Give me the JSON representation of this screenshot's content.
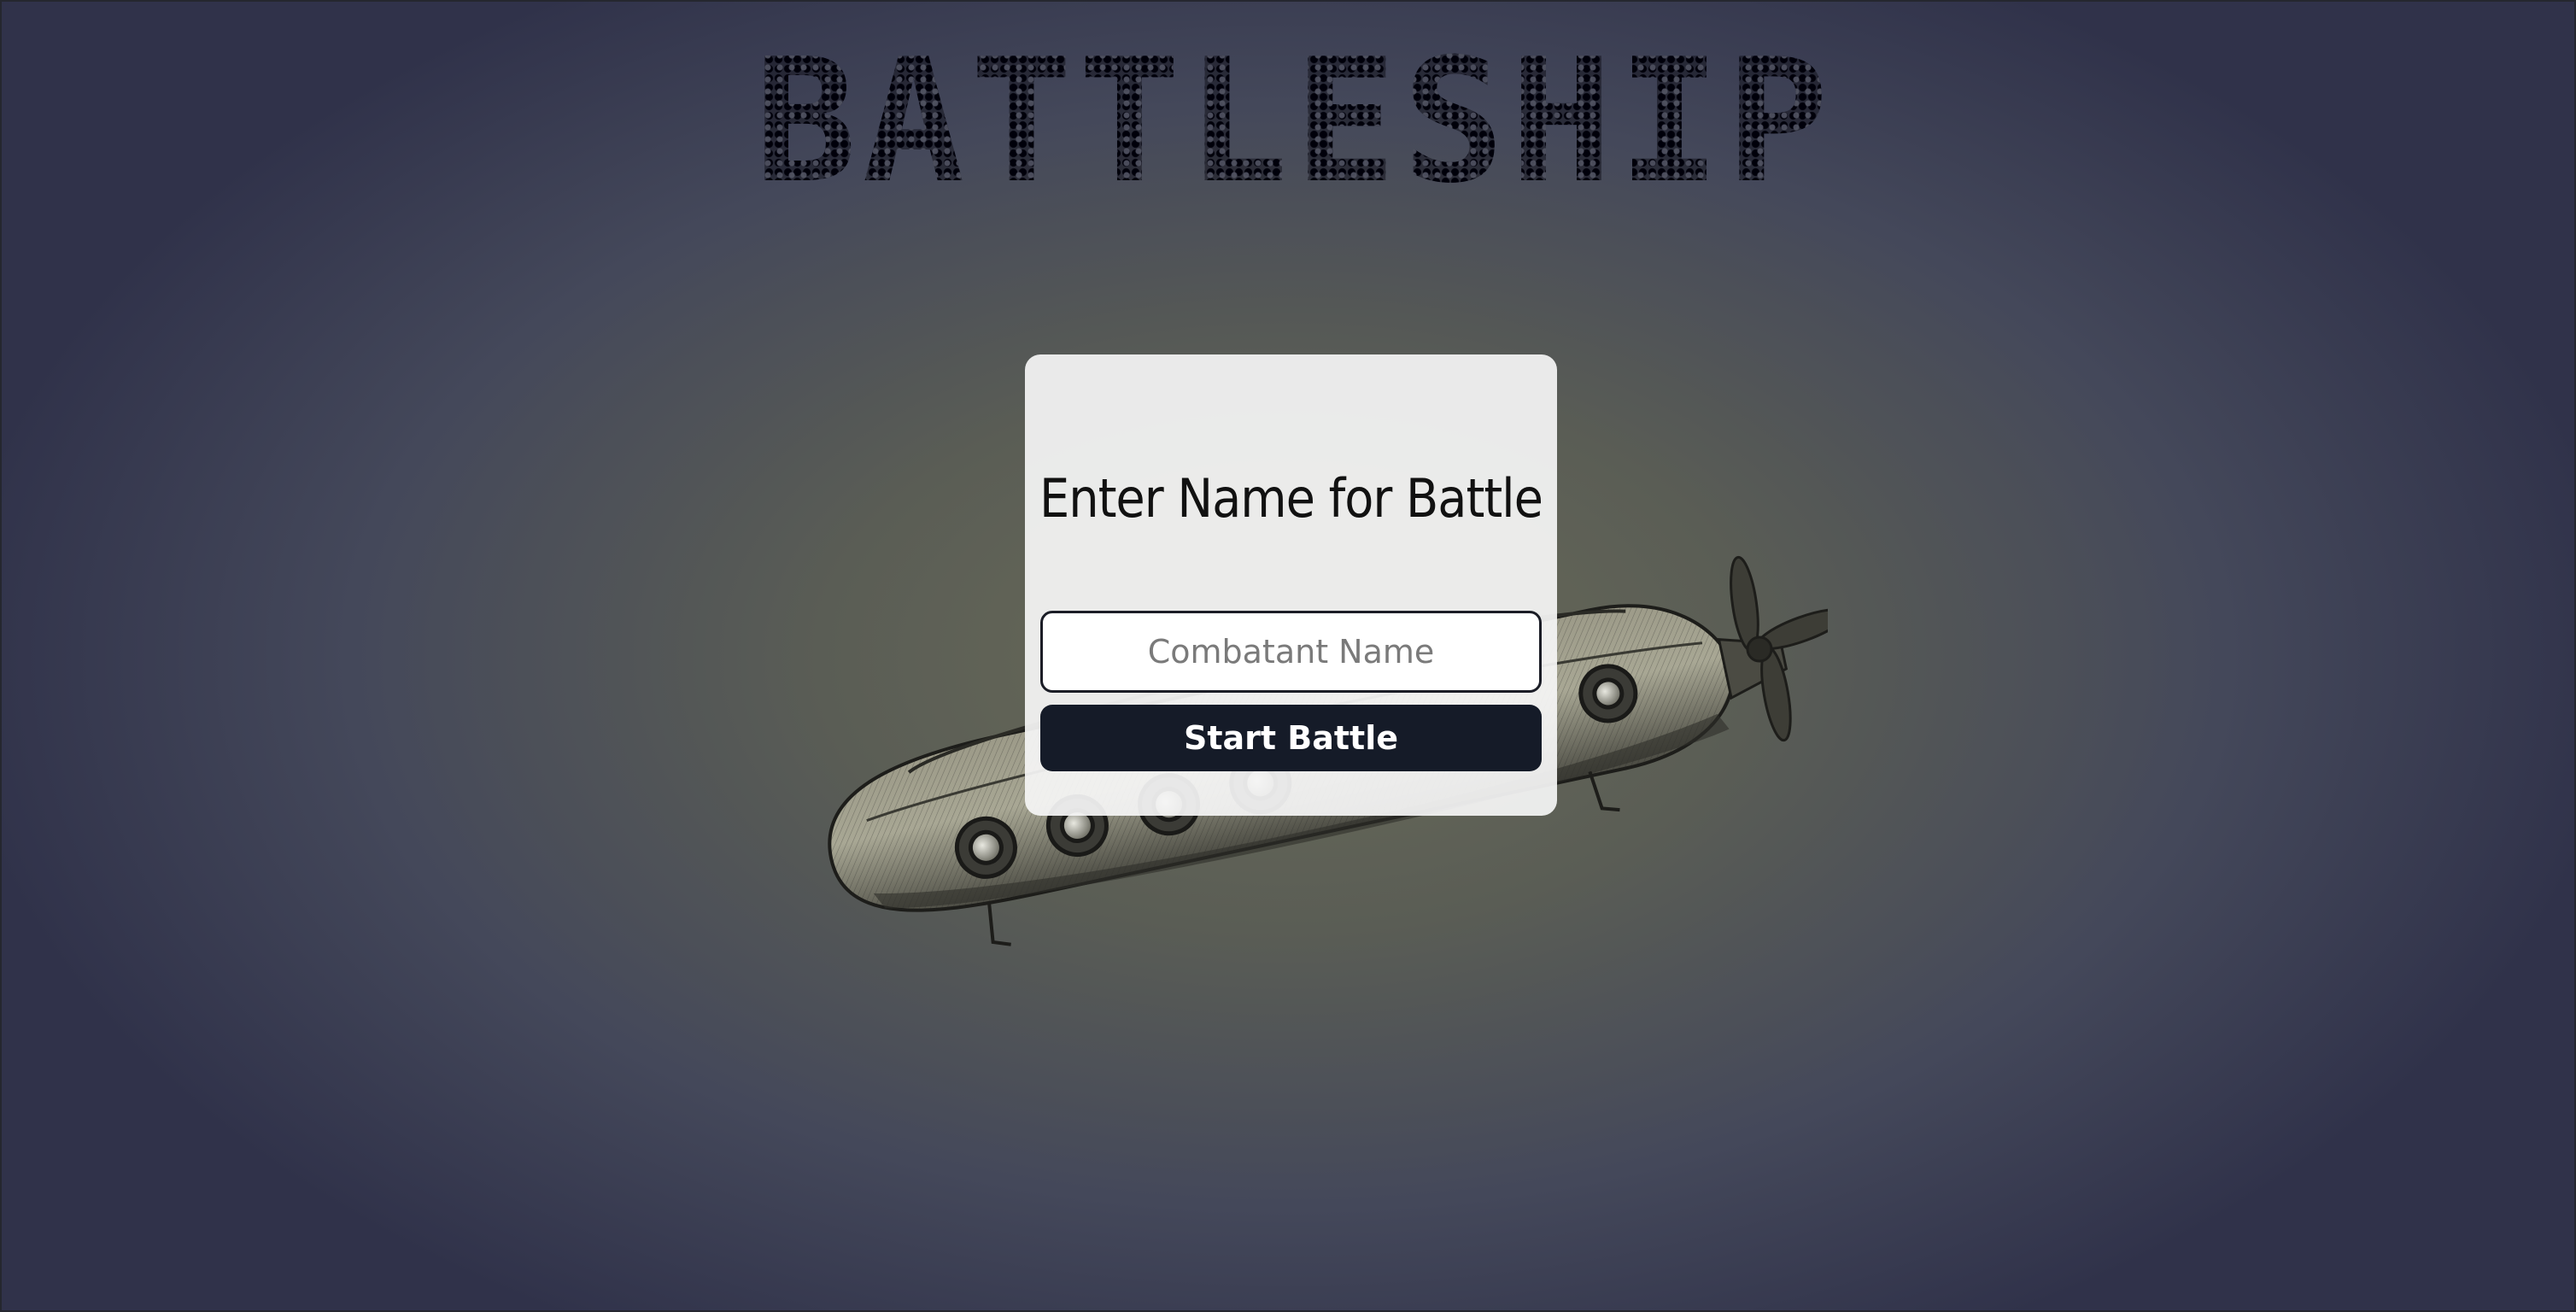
{
  "app": {
    "title": "BATTLESHIP"
  },
  "modal": {
    "heading": "Enter Name for Battle",
    "name_input": {
      "value": "",
      "placeholder": "Combatant Name"
    },
    "start_button_label": "Start Battle"
  },
  "colors": {
    "button_background": "#151b28",
    "modal_background": "#f5f5f5",
    "page_background_center": "#6a6b58",
    "page_background_edge": "#30324a"
  },
  "icons": {
    "hero_illustration": "submarine-illustration"
  }
}
